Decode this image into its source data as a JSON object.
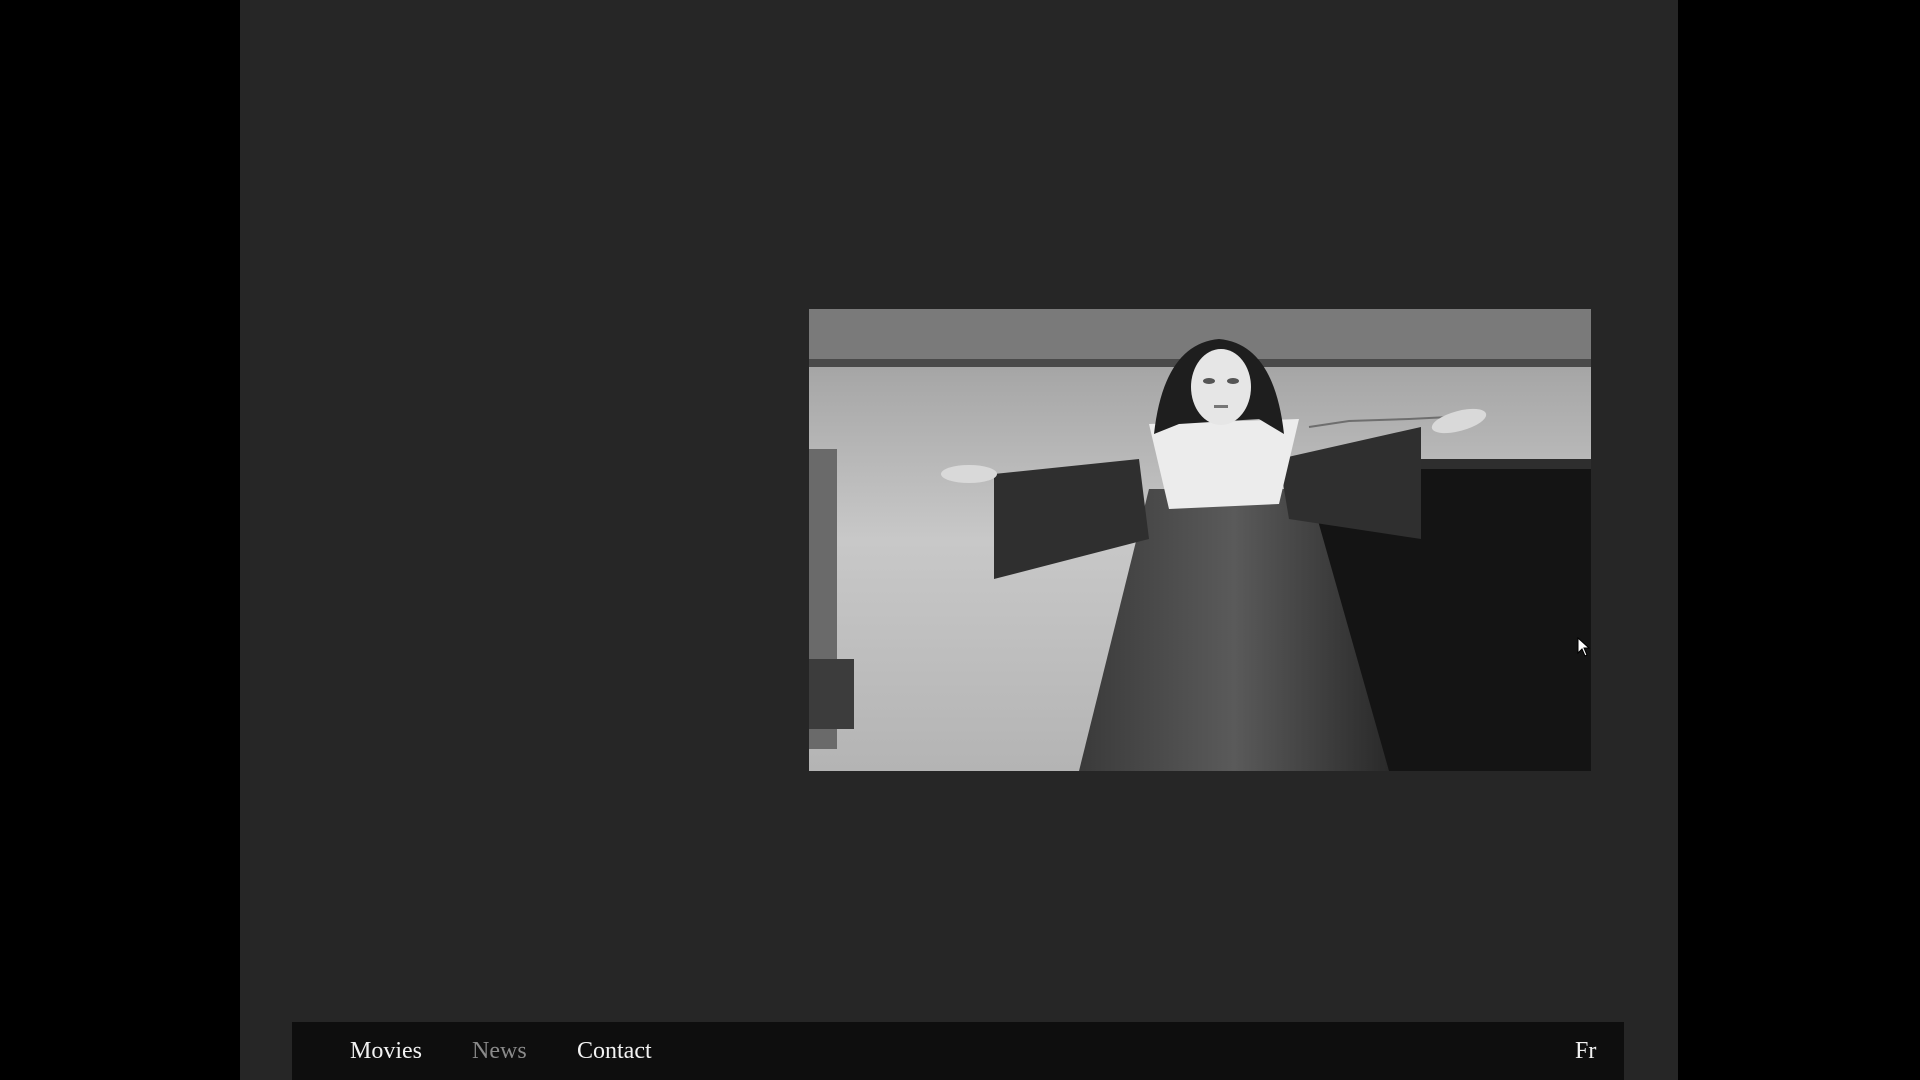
{
  "nav": {
    "links": [
      {
        "label": "Movies",
        "active": false
      },
      {
        "label": "News",
        "active": true
      },
      {
        "label": "Contact",
        "active": false
      }
    ],
    "language": "Fr"
  },
  "hero": {
    "image": "black-and-white film still of a nun with outstretched arms in front of a stone wall"
  },
  "colors": {
    "outer_background": "#000000",
    "page_background": "#262626",
    "navbar_background": "#0e0e0e",
    "nav_text": "#f2f2f2",
    "nav_text_muted": "#8a8a8a"
  }
}
